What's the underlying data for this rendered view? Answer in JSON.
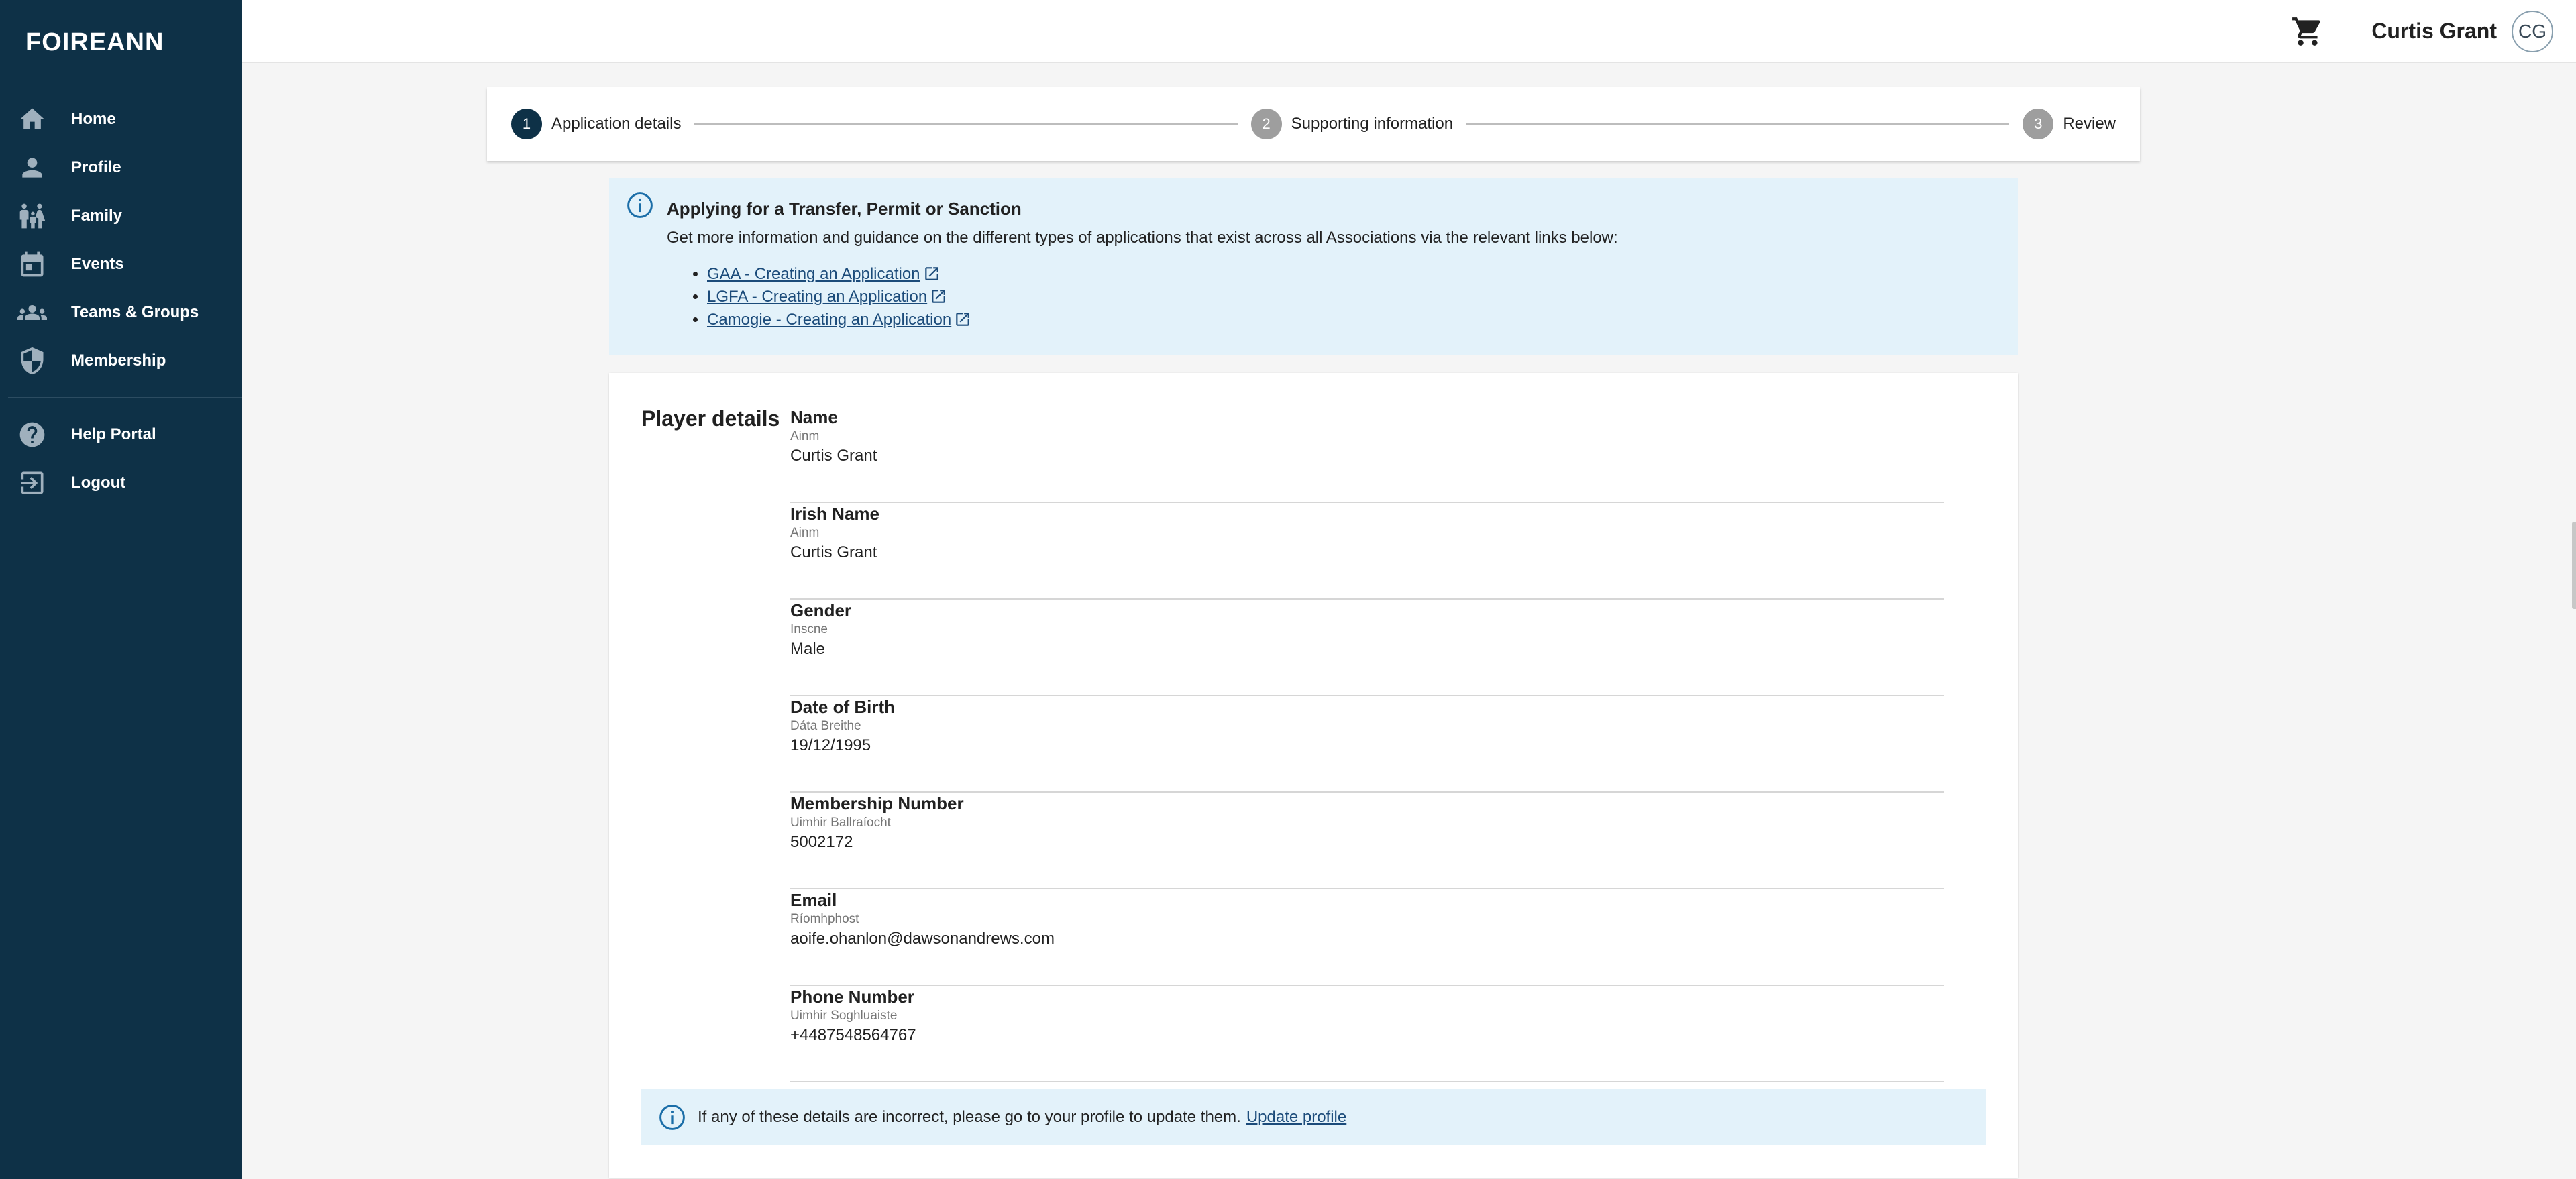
{
  "app": {
    "logo": "FOIREANN"
  },
  "sidebar": {
    "items": [
      {
        "label": "Home",
        "icon": "home-icon"
      },
      {
        "label": "Profile",
        "icon": "person-icon"
      },
      {
        "label": "Family",
        "icon": "family-icon"
      },
      {
        "label": "Events",
        "icon": "calendar-icon"
      },
      {
        "label": "Teams & Groups",
        "icon": "groups-icon"
      },
      {
        "label": "Membership",
        "icon": "shield-icon"
      }
    ],
    "secondary": [
      {
        "label": "Help Portal",
        "icon": "help-icon"
      },
      {
        "label": "Logout",
        "icon": "logout-icon"
      }
    ]
  },
  "topbar": {
    "user_name": "Curtis Grant",
    "avatar_initials": "CG"
  },
  "stepper": {
    "steps": [
      {
        "number": "1",
        "label": "Application details",
        "active": true
      },
      {
        "number": "2",
        "label": "Supporting information",
        "active": false
      },
      {
        "number": "3",
        "label": "Review",
        "active": false
      }
    ]
  },
  "info": {
    "title": "Applying for a Transfer, Permit or Sanction",
    "text": "Get more information and guidance on the different types of applications that exist across all Associations via the relevant links below:",
    "links": [
      "GAA - Creating an Application",
      "LGFA - Creating an Application",
      "Camogie - Creating an Application"
    ]
  },
  "player": {
    "title": "Player details",
    "fields": [
      {
        "label": "Name",
        "irish": "Ainm",
        "value": "Curtis Grant"
      },
      {
        "label": "Irish Name",
        "irish": "Ainm",
        "value": "Curtis Grant"
      },
      {
        "label": "Gender",
        "irish": "Inscne",
        "value": "Male"
      },
      {
        "label": "Date of Birth",
        "irish": "Dáta Breithe",
        "value": "19/12/1995"
      },
      {
        "label": "Membership Number",
        "irish": "Uimhir Ballraíocht",
        "value": "5002172"
      },
      {
        "label": "Email",
        "irish": "Ríomhphost",
        "value": "aoife.ohanlon@dawsonandrews.com"
      },
      {
        "label": "Phone Number",
        "irish": "Uimhir Soghluaiste",
        "value": "+4487548564767"
      }
    ],
    "notice_text": "If any of these details are incorrect, please go to your profile to update them.",
    "notice_link": "Update profile"
  },
  "colors": {
    "sidebar_bg": "#0e3147",
    "info_bg": "#e3f2fa",
    "link": "#1b4b7a"
  }
}
